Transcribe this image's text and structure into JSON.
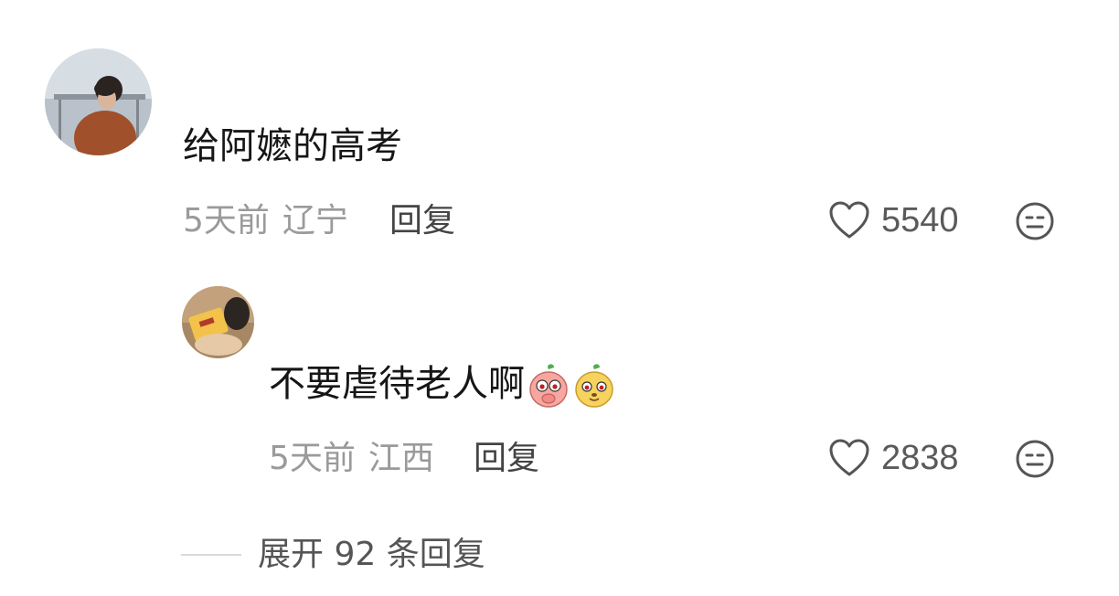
{
  "comments": [
    {
      "text": "给阿嬷的高考",
      "time": "5天前",
      "location": "辽宁",
      "reply_label": "回复",
      "likes": "5540"
    }
  ],
  "replies": [
    {
      "text": "不要虐待老人啊",
      "emojis": [
        "peach-face-emoji",
        "yellow-face-emoji"
      ],
      "time": "5天前",
      "location": "江西",
      "reply_label": "回复",
      "likes": "2838"
    }
  ],
  "expand": {
    "label": "展开 92 条回复"
  },
  "colors": {
    "primary_text": "#161616",
    "meta_text": "#9a9a9a",
    "reply_text": "#444444"
  }
}
